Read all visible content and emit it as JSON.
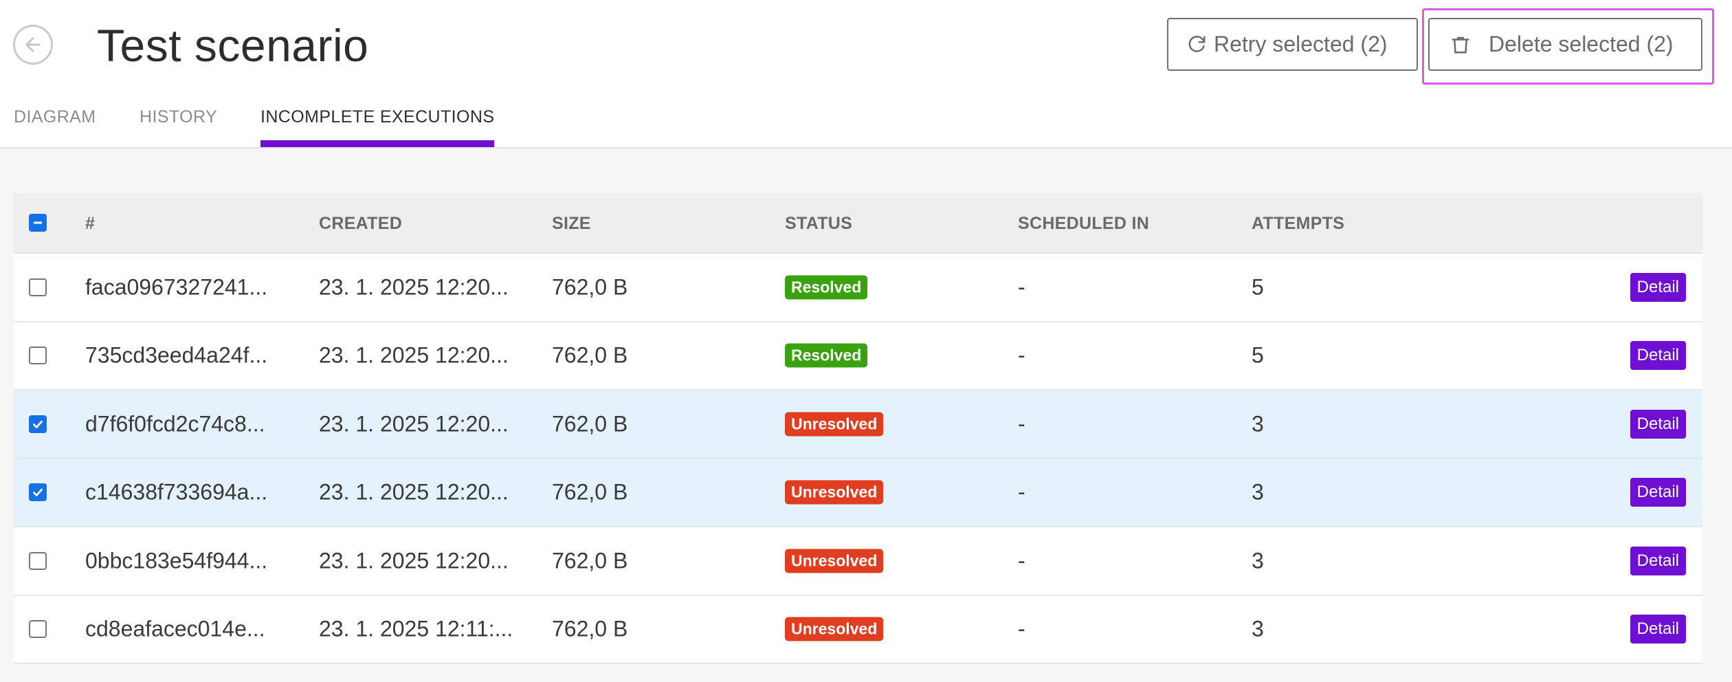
{
  "header": {
    "title": "Test scenario",
    "back_icon": "arrow-left-icon",
    "retry_label": "Retry selected (2)",
    "retry_icon": "refresh-icon",
    "delete_label": "Delete selected (2)",
    "delete_icon": "trash-icon"
  },
  "tabs": [
    {
      "label": "DIAGRAM",
      "active": false
    },
    {
      "label": "HISTORY",
      "active": false
    },
    {
      "label": "INCOMPLETE EXECUTIONS",
      "active": true
    }
  ],
  "colors": {
    "accent": "#6f0fd1",
    "resolved": "#3aa10f",
    "unresolved": "#e13d20",
    "checkbox": "#1670e6",
    "selected_row": "#e4f2fc"
  },
  "table": {
    "columns": [
      "#",
      "CREATED",
      "SIZE",
      "STATUS",
      "SCHEDULED IN",
      "ATTEMPTS"
    ],
    "rows": [
      {
        "checked": false,
        "id": "faca0967327241...",
        "created": "23. 1. 2025 12:20...",
        "size": "762,0 B",
        "status": "Resolved",
        "scheduled": "-",
        "attempts": "5",
        "action": "Detail"
      },
      {
        "checked": false,
        "id": "735cd3eed4a24f...",
        "created": "23. 1. 2025 12:20...",
        "size": "762,0 B",
        "status": "Resolved",
        "scheduled": "-",
        "attempts": "5",
        "action": "Detail"
      },
      {
        "checked": true,
        "id": "d7f6f0fcd2c74c8...",
        "created": "23. 1. 2025 12:20...",
        "size": "762,0 B",
        "status": "Unresolved",
        "scheduled": "-",
        "attempts": "3",
        "action": "Detail"
      },
      {
        "checked": true,
        "id": "c14638f733694a...",
        "created": "23. 1. 2025 12:20...",
        "size": "762,0 B",
        "status": "Unresolved",
        "scheduled": "-",
        "attempts": "3",
        "action": "Detail"
      },
      {
        "checked": false,
        "id": "0bbc183e54f944...",
        "created": "23. 1. 2025 12:20...",
        "size": "762,0 B",
        "status": "Unresolved",
        "scheduled": "-",
        "attempts": "3",
        "action": "Detail"
      },
      {
        "checked": false,
        "id": "cd8eafacec014e...",
        "created": "23. 1. 2025 12:11:...",
        "size": "762,0 B",
        "status": "Unresolved",
        "scheduled": "-",
        "attempts": "3",
        "action": "Detail"
      }
    ]
  }
}
